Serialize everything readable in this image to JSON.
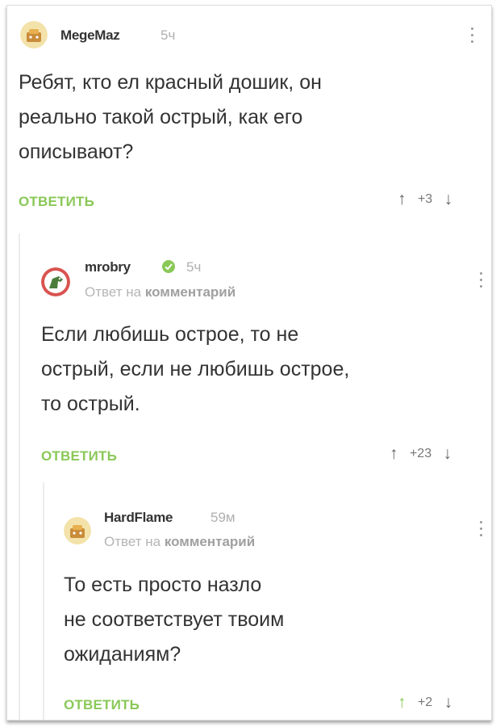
{
  "colors": {
    "accent": "#8ac858",
    "text": "#333333",
    "muted": "#b0b0b0"
  },
  "comments": [
    {
      "author": "MegeMaz",
      "time": "5ч",
      "reply_to": null,
      "text_lines": [
        "Ребят, кто ел красный дошик, он",
        "реально такой острый, как его",
        "описывают?"
      ],
      "reply_label": "ОТВЕТИТЬ",
      "rating": "+3",
      "avatar_icon": "default-avatar-icon"
    },
    {
      "author": "mrobry",
      "time": "5ч",
      "reply_to": {
        "prefix": "Ответ на",
        "target": "комментарий"
      },
      "text_lines": [
        "Если любишь острое, то не",
        "острый, если не любишь острое,",
        "то острый."
      ],
      "reply_label": "ОТВЕТИТЬ",
      "rating": "+23",
      "avatar_icon": "dinosaur-avatar-icon",
      "verified_icon": "check-circle-icon"
    },
    {
      "author": "HardFlame",
      "time": "59м",
      "reply_to": {
        "prefix": "Ответ на",
        "target": "комментарий"
      },
      "text_lines": [
        "То есть просто назло",
        "не соответствует твоим",
        "ожиданиям?"
      ],
      "reply_label": "ОТВЕТИТЬ",
      "rating": "+2",
      "avatar_icon": "default-avatar-icon",
      "upvoted": true
    }
  ]
}
